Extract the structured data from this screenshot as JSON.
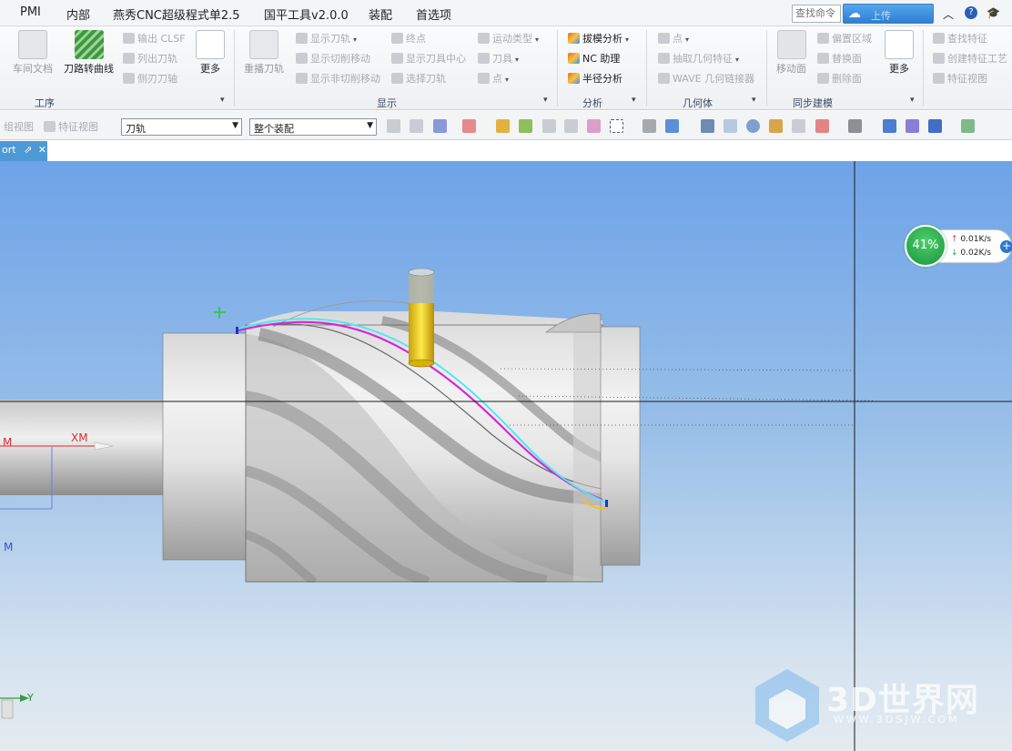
{
  "menubar": {
    "items": [
      "PMI",
      "内部",
      "燕秀CNC超级程式单2.5",
      "国平工具v2.0.0",
      "装配",
      "首选项"
    ],
    "search_placeholder": "查找命令",
    "cloud_label": "上传"
  },
  "ribbon": {
    "groups": {
      "process": "工序",
      "display": "显示",
      "analysis": "分析",
      "geometry": "几何体",
      "sync": "同步建模"
    },
    "process": {
      "lathe_doc": "车间文档",
      "toolpath_to_curve": "刀路转曲线",
      "output_clsf": "输出 CLSF",
      "list_toolpath": "列出刀轨",
      "side_edge_axis": "侧刃刀轴",
      "more": "更多"
    },
    "display": {
      "replay_toolpath": "重播刀轨",
      "show_toolpath": "显示刀轨",
      "show_cut_moves": "显示切削移动",
      "show_noncut_moves": "显示非切削移动",
      "endpoint": "终点",
      "show_tool_center": "显示刀具中心",
      "select_toolpath": "选择刀轨",
      "motion_type": "运动类型",
      "tool": "刀具",
      "point": "点"
    },
    "analysis": {
      "draft_analysis": "拔模分析",
      "nc_assistant": "NC 助理",
      "radius_analysis": "半径分析"
    },
    "geometry": {
      "point": "点",
      "extract_feature": "抽取几何特征",
      "wave_linker": "WAVE 几何链接器"
    },
    "sync": {
      "move_face": "移动面",
      "offset_region": "偏置区域",
      "replace_face": "替换面",
      "delete_face": "删除面",
      "more": "更多"
    },
    "feature": {
      "find_feature": "查找特征",
      "create_feature": "创建特征工艺",
      "feature_view": "特征视图"
    }
  },
  "toolbar2": {
    "assembly_view": "组视图",
    "feature_view": "特征视图",
    "filter_select": "刀轨",
    "scope_select": "整个装配"
  },
  "tab": {
    "label": "ort"
  },
  "viewport": {
    "axis_xm": "XM",
    "axis_m1": "M",
    "axis_m2": "M",
    "axis_y": "Y"
  },
  "speed_widget": {
    "percent": "41%",
    "upload": "0.01K/s",
    "download": "0.02K/s"
  },
  "watermark": {
    "title": "3D世界网",
    "url": "WWW.3DSJW.COM"
  }
}
